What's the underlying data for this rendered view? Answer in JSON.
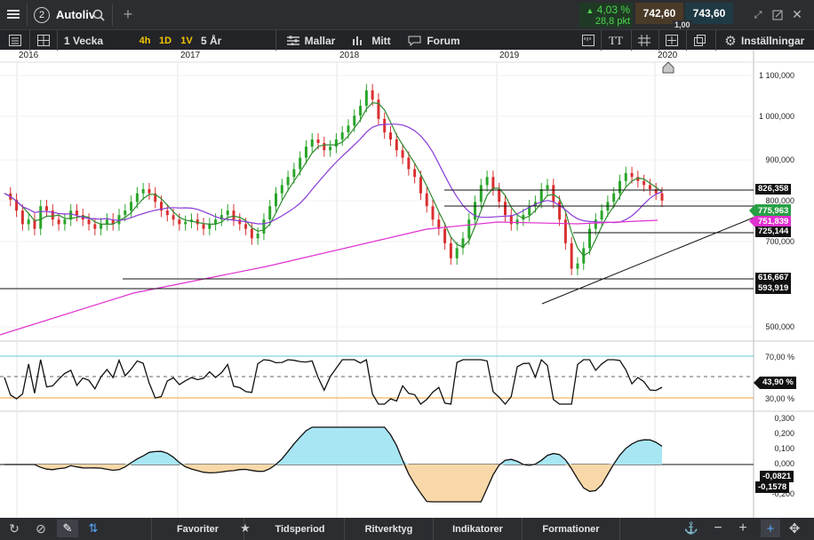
{
  "app": {
    "tab_number": "2",
    "tab_title": "Autoliv",
    "change_pct": "4,03 %",
    "change_pts": "28,8 pkt",
    "bid": "742,60",
    "ask": "743,60",
    "spread": "1,00"
  },
  "toolbar": {
    "period": "1 Vecka",
    "btn_4h": "4h",
    "btn_1d": "1D",
    "btn_1v": "1V",
    "range": "5 År",
    "templates": "Mallar",
    "mine": "Mitt",
    "forum": "Forum",
    "text_tool": "TT",
    "settings": "Inställningar"
  },
  "axis": {
    "years": [
      "2016",
      "2017",
      "2018",
      "2019",
      "2020"
    ],
    "price_ticks": [
      "1 100,000",
      "1 000,000",
      "900,000",
      "800,000",
      "700,000",
      "600,000",
      "500,000"
    ],
    "rsi_ticks": [
      "70,00 %",
      "30,00 %"
    ],
    "osc_ticks": [
      "0,300",
      "0,200",
      "0,100",
      "0,000",
      "-0,100",
      "-0,200"
    ]
  },
  "tags": {
    "level1": "826,358",
    "price": "775,963",
    "ma_long": "751,839",
    "level2": "725,144",
    "level3": "616,667",
    "level4": "593,919",
    "rsi": "43,90 %",
    "osc1": "-0,0821",
    "osc2": "-0,1578"
  },
  "colors": {
    "up": "#2aa52a",
    "down": "#d93030",
    "ma_short": "#2e8b2e",
    "ma_mid": "#8a3ad8",
    "ma_long": "#e030d0",
    "price_tag": "#27a043",
    "rsi_upper": "#5cc8d8",
    "rsi_lower": "#f0a030",
    "osc_pos": "#a8e6f4",
    "osc_neg": "#f8d8a8"
  },
  "bottombar": {
    "favorites": "Favoriter",
    "period": "Tidsperiod",
    "drawing": "Ritverktyg",
    "indicators": "Indikatorer",
    "patterns": "Formationer"
  }
}
